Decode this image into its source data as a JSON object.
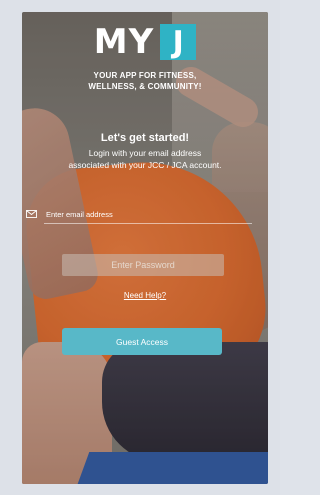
{
  "logo": {
    "word": "MY",
    "letter": "J"
  },
  "tagline": {
    "line1": "YOUR APP FOR FITNESS,",
    "line2": "WELLNESS, & COMMUNITY!"
  },
  "login": {
    "heading": "Let's get started!",
    "subtitle_line1": "Login with your email address",
    "subtitle_line2": "associated with your JCC / JCA account.",
    "email_placeholder": "Enter email address",
    "password_placeholder": "Enter Password",
    "help_link": "Need Help?",
    "guest_button": "Guest Access"
  },
  "icons": {
    "email": "mail-icon"
  },
  "colors": {
    "brand_teal": "#2fb3c5",
    "button_teal": "#58b8c8"
  }
}
